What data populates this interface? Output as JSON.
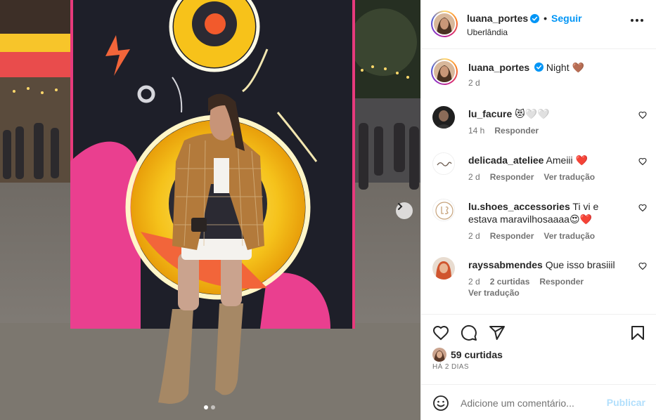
{
  "post": {
    "author": "luana_portes",
    "location": "Uberlândia",
    "follow_label": "Seguir",
    "separator": "•",
    "caption": "Night",
    "caption_emoji": "🤎",
    "caption_age": "2 d",
    "likes": "59 curtidas",
    "date": "HÁ 2 DIAS",
    "comment_placeholder": "Adicione um comentário...",
    "publish_label": "Publicar",
    "carousel": {
      "total": 2,
      "current": 1
    }
  },
  "comments": [
    {
      "user": "lu_facure",
      "text": "😻🤍🤍",
      "age": "14 h",
      "actions": [
        "Responder"
      ]
    },
    {
      "user": "delicada_ateliee",
      "text": "Ameiii ❤️",
      "age": "2 d",
      "actions": [
        "Responder",
        "Ver tradução"
      ]
    },
    {
      "user": "lu.shoes_accessories",
      "text": "Ti vi e estava maravilhosaaaa😍❤️",
      "age": "2 d",
      "actions": [
        "Responder",
        "Ver tradução"
      ]
    },
    {
      "user": "rayssabmendes",
      "text": "Que isso brasiiil",
      "age": "2 d",
      "likes": "2 curtidas",
      "actions": [
        "Responder"
      ],
      "extra": "Ver tradução"
    }
  ],
  "icons": {
    "verified": "verified-badge-icon",
    "more": "more-options-icon",
    "like": "heart-icon",
    "comment": "comment-icon",
    "share": "share-icon",
    "save": "bookmark-icon",
    "emoji": "emoji-icon",
    "next": "chevron-right-icon"
  },
  "colors": {
    "accent": "#0095f6",
    "muted": "#737373",
    "publish_disabled": "#b2dffc"
  }
}
